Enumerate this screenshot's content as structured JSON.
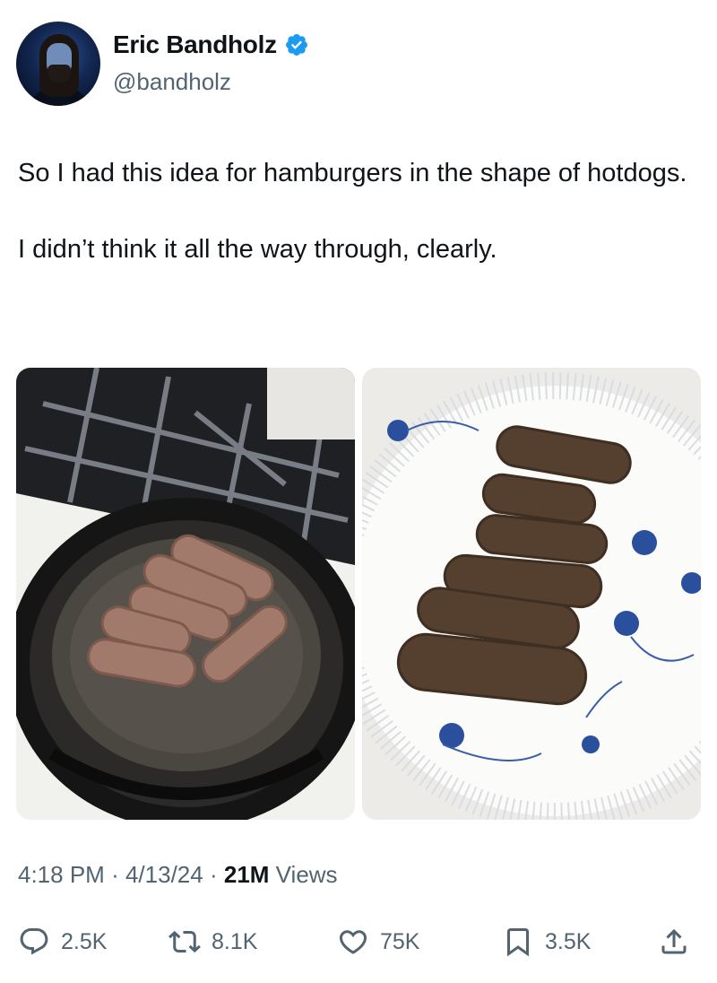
{
  "author": {
    "display_name": "Eric Bandholz",
    "handle": "@bandholz",
    "verified_icon": "verified-badge-icon",
    "avatar_icon": "avatar-photo"
  },
  "tweet": {
    "paragraphs": [
      "So I had this idea for hamburgers in the shape of hotdogs.",
      "I didn’t think it all the way through, clearly."
    ],
    "media": [
      {
        "name": "photo-skillet",
        "subject": "skillet-with-meat"
      },
      {
        "name": "photo-plate",
        "subject": "plate-with-meat"
      }
    ],
    "time": "4:18 PM",
    "separator": "·",
    "date": "4/13/24",
    "views_count": "21M",
    "views_label": "Views"
  },
  "actions": {
    "reply": {
      "count": "2.5K",
      "icon": "reply-icon"
    },
    "repost": {
      "count": "8.1K",
      "icon": "repost-icon"
    },
    "like": {
      "count": "75K",
      "icon": "like-icon"
    },
    "bookmark": {
      "count": "3.5K",
      "icon": "bookmark-icon"
    },
    "share": {
      "icon": "share-icon"
    }
  },
  "colors": {
    "text": "#0f1419",
    "secondary": "#536471",
    "verified": "#1d9bf0",
    "background": "#ffffff"
  }
}
